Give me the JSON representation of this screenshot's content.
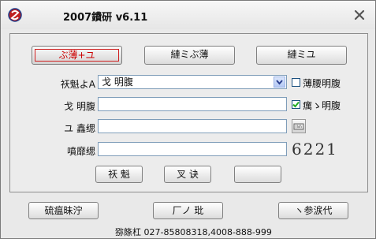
{
  "window": {
    "title": "2007鐨研  v6.11"
  },
  "tabs": [
    {
      "label": "ぶ薄+ユ",
      "active": true
    },
    {
      "label": "縺ミぶ薄",
      "active": false
    },
    {
      "label": "縺ミユ",
      "active": false
    }
  ],
  "form": {
    "account_type_label": "祆魁よA",
    "account_type_value": "戈  明腹",
    "remember_label": "薄腰明腹",
    "account_label": "戈  明腹",
    "save_label": "癘ゝ明腹",
    "password_label": "ユ  鑫缌",
    "captcha_label": "噴靡缌",
    "captcha_text": "6221"
  },
  "action_buttons": {
    "login": "祆 魁",
    "reset": "叉 诀",
    "blank": ""
  },
  "footer_buttons": {
    "left": "硫瘟昧泞",
    "middle": "厂ノ  玭",
    "right": "ヽ参涙代"
  },
  "footer_text": "猕篨杠   027-85808318,4008-888-999",
  "colors": {
    "active_tab_text": "#cc0000",
    "active_tab_border": "#d02020",
    "checkbox_check": "#22aa22"
  }
}
